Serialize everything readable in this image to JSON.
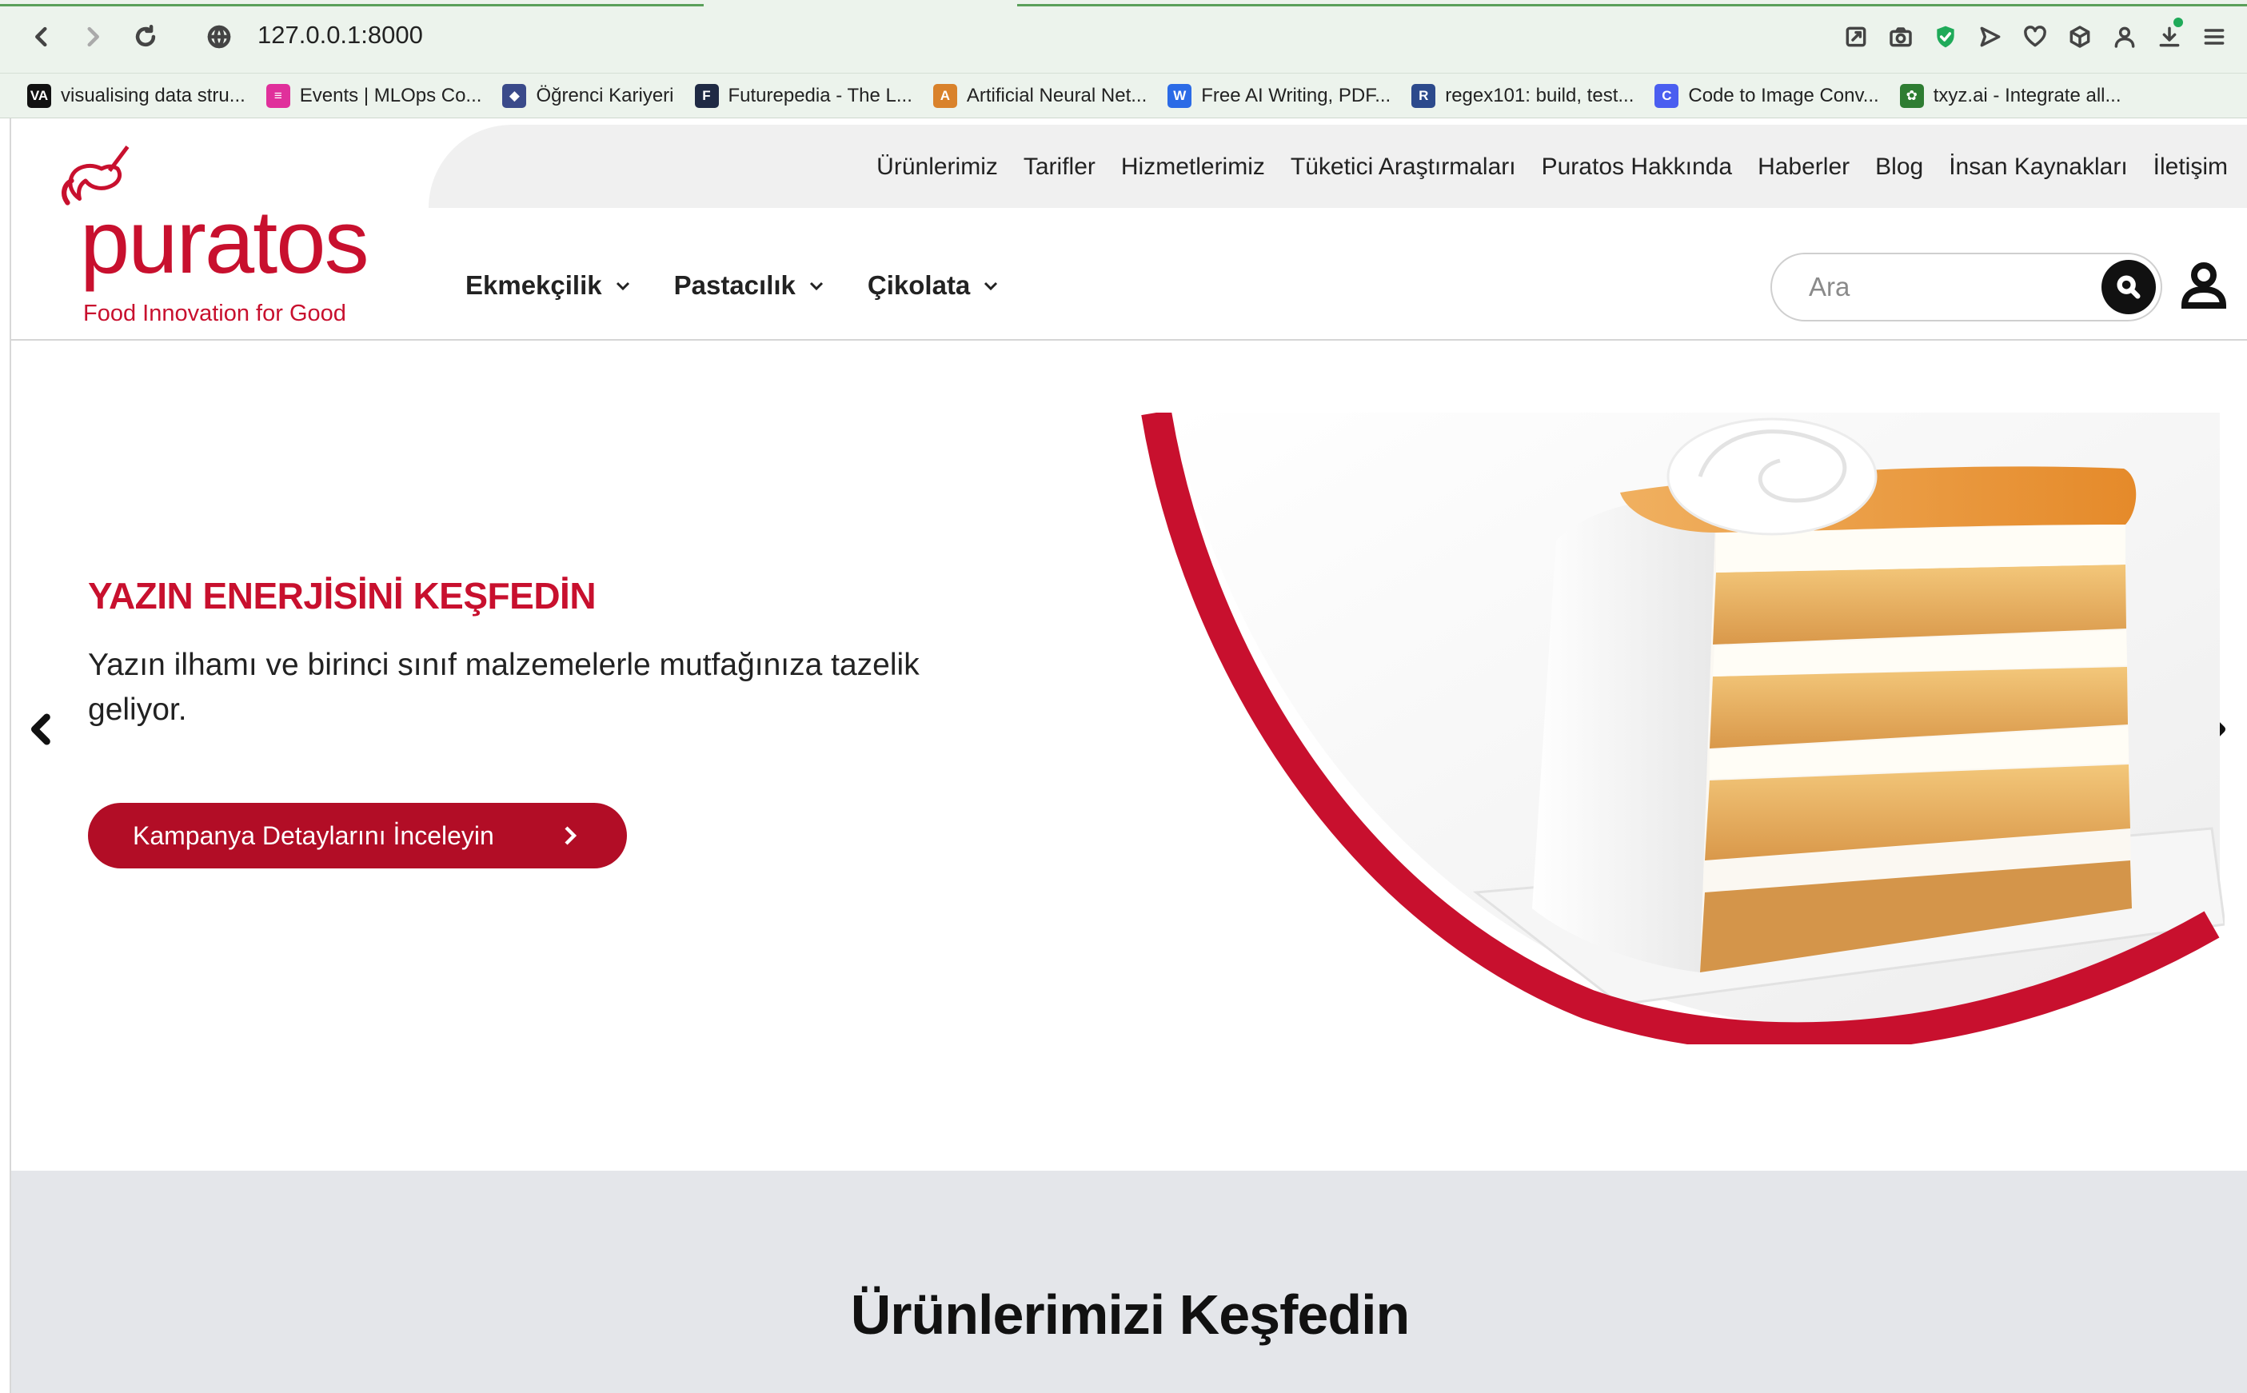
{
  "browser": {
    "url": "127.0.0.1:8000",
    "bookmarks": [
      {
        "label": "visualising data stru...",
        "icon": "va-icon",
        "color": "#111111",
        "glyph": "VA"
      },
      {
        "label": "Events | MLOps Co...",
        "icon": "mlops-icon",
        "color": "#e0309b",
        "glyph": "≡"
      },
      {
        "label": "Öğrenci Kariyeri",
        "icon": "shield-icon",
        "color": "#3a4a8a",
        "glyph": "◆"
      },
      {
        "label": "Futurepedia - The L...",
        "icon": "futurepedia-icon",
        "color": "#1f2a44",
        "glyph": "F"
      },
      {
        "label": "Artificial Neural Net...",
        "icon": "neural-net-icon",
        "color": "#d9822b",
        "glyph": "A"
      },
      {
        "label": "Free AI Writing, PDF...",
        "icon": "ai-writing-icon",
        "color": "#2b6be6",
        "glyph": "W"
      },
      {
        "label": "regex101: build, test...",
        "icon": "regex-icon",
        "color": "#2c4a8c",
        "glyph": "R"
      },
      {
        "label": "Code to Image Conv...",
        "icon": "code-image-icon",
        "color": "#4a5ef0",
        "glyph": "C"
      },
      {
        "label": "txyz.ai - Integrate all...",
        "icon": "txyz-icon",
        "color": "#2e7d32",
        "glyph": "✿"
      }
    ]
  },
  "site": {
    "logo_word": "puratos",
    "logo_tagline": "Food Innovation for Good",
    "brand_color": "#c8102e",
    "top_nav": [
      "Ürünlerimiz",
      "Tarifler",
      "Hizmetlerimiz",
      "Tüketici Araştırmaları",
      "Puratos Hakkında",
      "Haberler",
      "Blog",
      "İnsan Kaynakları",
      "İletişim"
    ],
    "main_nav": [
      "Ekmekçilik",
      "Pastacılık",
      "Çikolata"
    ],
    "search_placeholder": "Ara"
  },
  "hero": {
    "kicker": "YAZIN ENERJİSİNİ KEŞFEDİN",
    "description": "Yazın ilhamı ve birinci sınıf malzemelerle mutfağınıza tazelik geliyor.",
    "cta_label": "Kampanya Detaylarını İnceleyin",
    "cta_color": "#b20d26"
  },
  "products": {
    "title": "Ürünlerimizi Keşfedin"
  }
}
